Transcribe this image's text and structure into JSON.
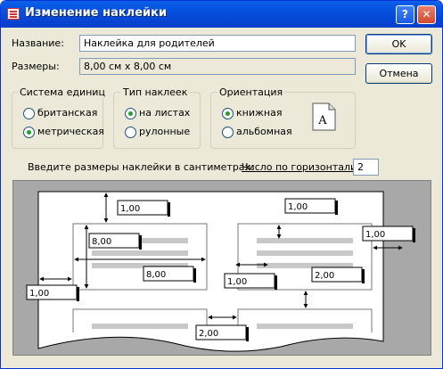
{
  "window": {
    "title": "Изменение наклейки",
    "help_glyph": "?",
    "close_glyph": "✕"
  },
  "name_field": {
    "label": "Название:",
    "value": "Наклейка для родителей"
  },
  "size_field": {
    "label": "Размеры:",
    "value": "8,00 см x 8,00 см"
  },
  "buttons": {
    "ok": "OK",
    "cancel": "Отмена"
  },
  "units_group": {
    "title": "Система единиц",
    "options": [
      {
        "label": "британская",
        "selected": false
      },
      {
        "label": "метрическая",
        "selected": true
      }
    ]
  },
  "type_group": {
    "title": "Тип наклеек",
    "options": [
      {
        "label": "на листах",
        "selected": true
      },
      {
        "label": "рулонные",
        "selected": false
      }
    ]
  },
  "orient_group": {
    "title": "Ориентация",
    "options": [
      {
        "label": "книжная",
        "selected": true
      },
      {
        "label": "альбомная",
        "selected": false
      }
    ],
    "icon_letter": "A"
  },
  "dims_prompt": "Введите размеры наклейки в сантиметрах:",
  "across": {
    "label": "Число по горизонтали:",
    "value": "2"
  },
  "preview_values": {
    "top_margin": "1,00",
    "top_margin_right": "1,00",
    "label_height": "8,00",
    "label_width": "8,00",
    "side_margin_left": "1,00",
    "side_margin_right": "1,00",
    "number_label_left": "1,00",
    "row_gap": "2,00",
    "column_gap": "2,00"
  },
  "colors": {
    "title_bar": "#0a5fe8",
    "dialog_bg": "#ece9d8",
    "preview_bg": "#a8a8a8"
  }
}
